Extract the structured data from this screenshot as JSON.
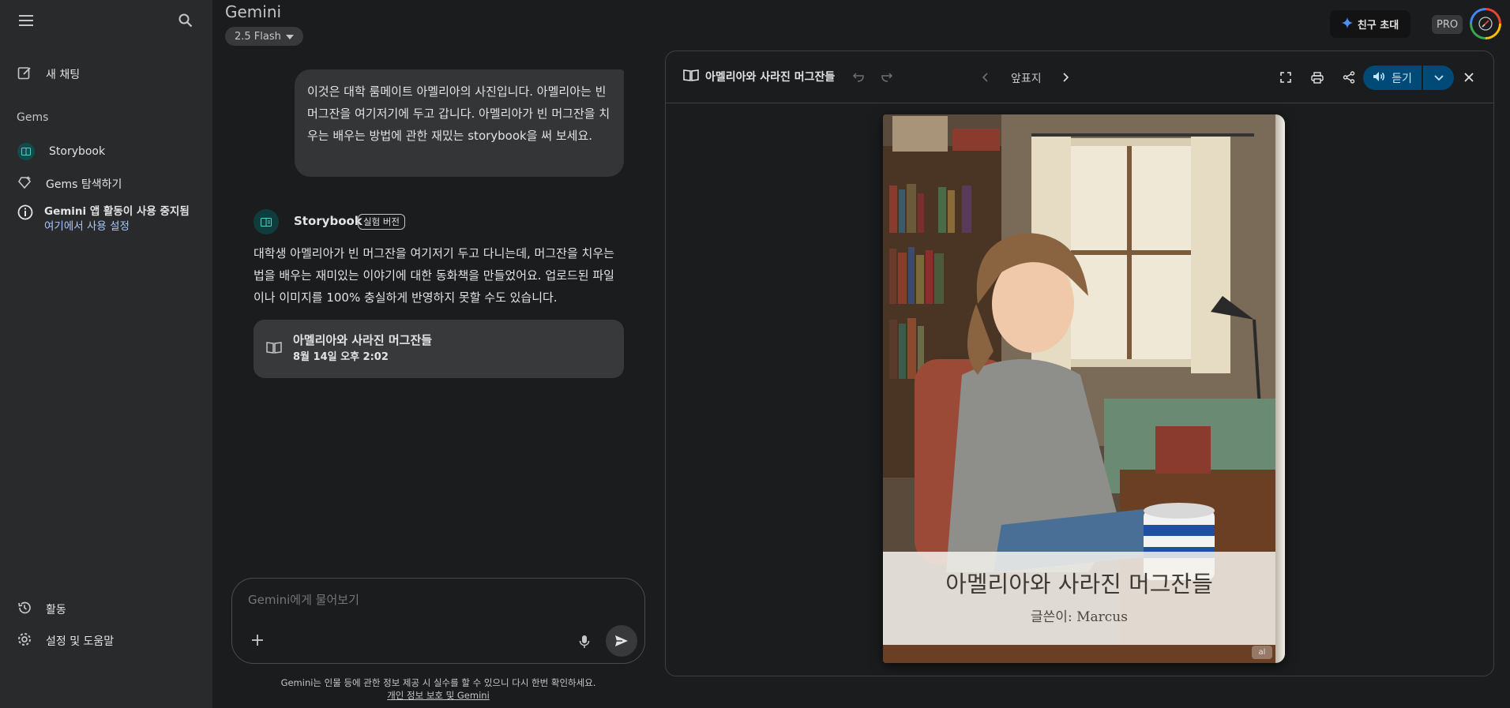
{
  "sidebar": {
    "new_chat": "새 채팅",
    "gems_heading": "Gems",
    "gem_items": [
      {
        "label": "Storybook"
      },
      {
        "label": "Gems 탐색하기"
      }
    ],
    "notice_title": "Gemini 앱 활동이 사용 중지됨",
    "notice_link": "여기에서 사용 설정",
    "activity": "활동",
    "settings": "설정 및 도움말"
  },
  "header": {
    "brand": "Gemini",
    "model": "2.5 Flash",
    "invite": "친구 초대",
    "pro": "PRO"
  },
  "chat": {
    "user_message": "이것은 대학 룸메이트 아멜리아의 사진입니다. 아멜리아는 빈 머그잔을 여기저기에 두고 갑니다. 아멜리아가 빈 머그잔을 치우는 배우는 방법에 관한 재밌는 storybook을 써 보세요.",
    "gem_name": "Storybook",
    "gem_badge": "실험 버전",
    "response": "대학생 아멜리아가 빈 머그잔을 여기저기 두고 다니는데, 머그잔을 치우는 법을 배우는 재미있는 이야기에 대한 동화책을 만들었어요. 업로드된 파일이나 이미지를 100% 충실하게 반영하지 못할 수도 있습니다.",
    "card_title": "아멜리아와 사라진 머그잔들",
    "card_date": "8월 14일 오후 2:02"
  },
  "input": {
    "placeholder": "Gemini에게 물어보기"
  },
  "footer": {
    "disclaimer": "Gemini는 인물 등에 관한 정보 제공 시 실수를 할 수 있으니 다시 한번 확인하세요.",
    "privacy_link": "개인 정보 보호 및 Gemini"
  },
  "panel": {
    "title": "아멜리아와 사라진 머그잔들",
    "page_label": "앞표지",
    "listen": "듣기",
    "cover_title": "아멜리아와 사라진 머그잔들",
    "cover_author": "글쓴이: Marcus",
    "cover_corner": "al"
  },
  "colors": {
    "background": "#1b1c1d",
    "sidebar": "#282a2c",
    "accent_listen": "#004a77",
    "link": "#a8c7fa"
  }
}
